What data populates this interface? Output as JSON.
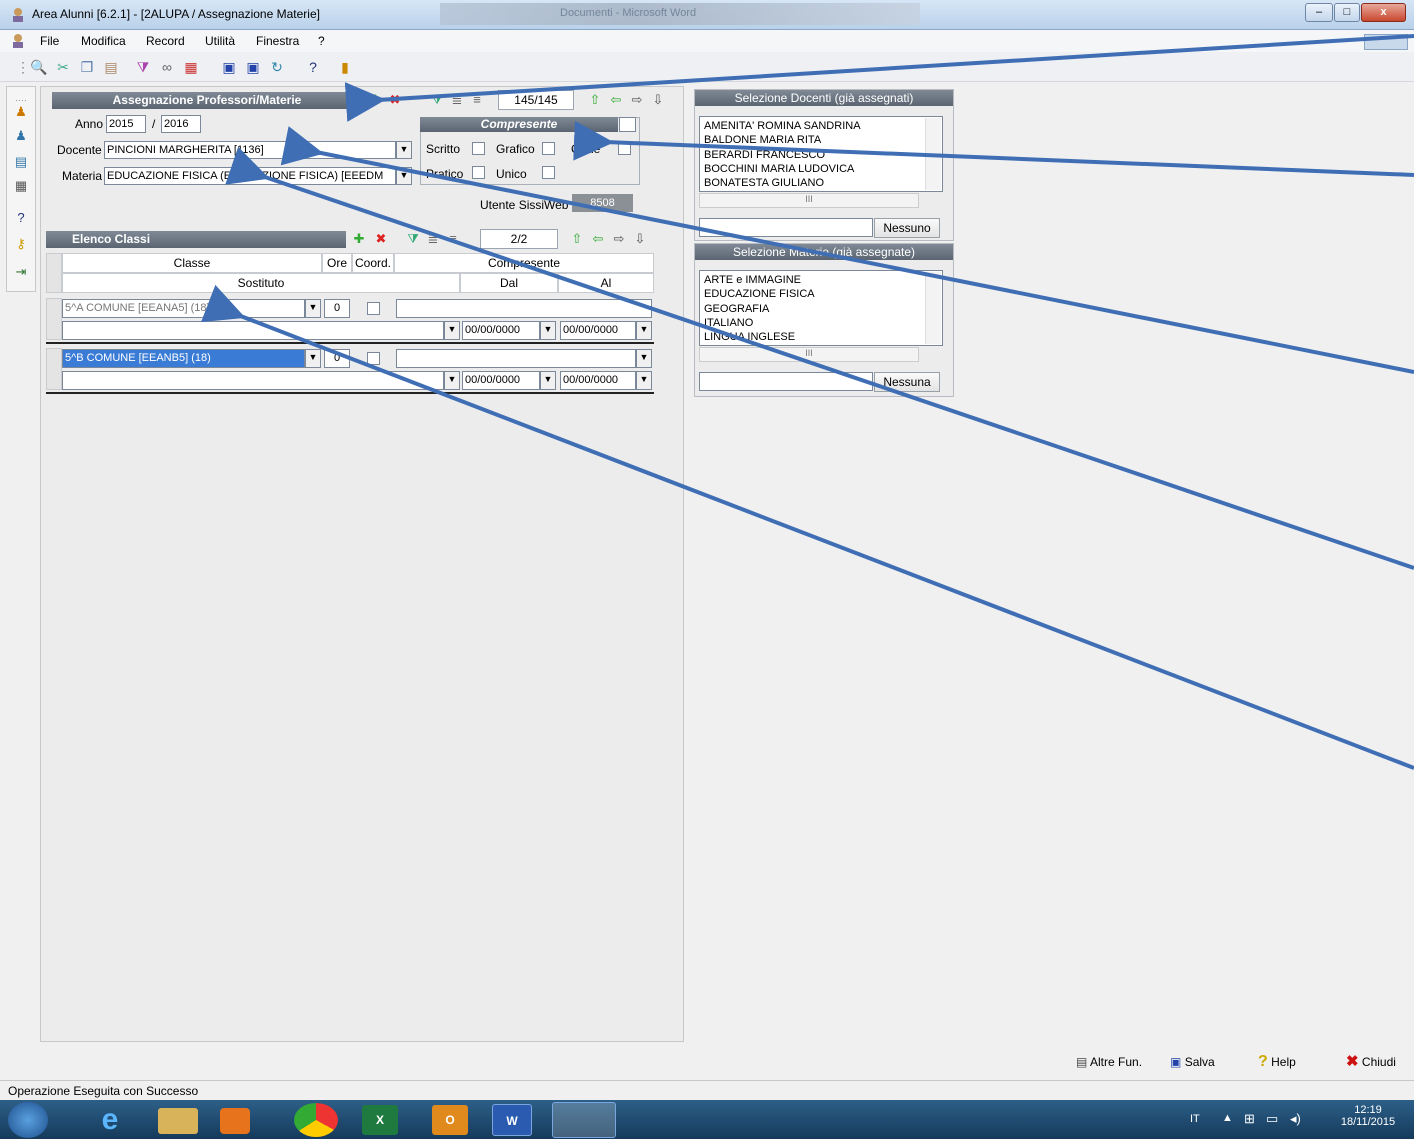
{
  "window": {
    "title": "Area Alunni [6.2.1] - [2ALUPA / Assegnazione Materie]",
    "blurred_title": "Documenti - Microsoft Word",
    "min_label": "–",
    "max_label": "□",
    "close_label": "x"
  },
  "menu": [
    "File",
    "Modifica",
    "Record",
    "Utilità",
    "Finestra",
    "?"
  ],
  "assign_panel": {
    "header": "Assegnazione Professori/Materie",
    "record_counter": "145/145",
    "anno_label": "Anno",
    "anno_from": "2015",
    "anno_sep": "/",
    "anno_to": "2016",
    "docente_label": "Docente",
    "docente_value": "PINCIONI MARGHERITA [1136]",
    "materia_label": "Materia",
    "materia_value": "EDUCAZIONE FISICA (EDUCAZIONE FISICA) [EEEDM",
    "compresente_header": "Compresente",
    "scritto_label": "Scritto",
    "grafico_label": "Grafico",
    "orale_label": "Orale",
    "pratico_label": "Pratico",
    "unico_label": "Unico",
    "utente_label": "Utente SissiWeb",
    "utente_value": "8508"
  },
  "classes_panel": {
    "header": "Elenco Classi",
    "record_counter": "2/2",
    "col_classe": "Classe",
    "col_ore": "Ore",
    "col_coord": "Coord.",
    "col_compresente": "Compresente",
    "col_sostituto": "Sostituto",
    "col_dal": "Dal",
    "col_al": "Al",
    "rows": [
      {
        "classe": "5^A COMUNE [EEANA5] (18)",
        "ore": "0",
        "dal": "00/00/0000",
        "al": "00/00/0000"
      },
      {
        "classe": "5^B COMUNE [EEANB5] (18)",
        "ore": "0",
        "dal": "00/00/0000",
        "al": "00/00/0000"
      }
    ]
  },
  "docenti_panel": {
    "header": "Selezione Docenti (già assegnati)",
    "items": [
      "AMENITA' ROMINA SANDRINA",
      "BALDONE MARIA RITA",
      "BERARDI FRANCESCO",
      "BOCCHINI MARIA LUDOVICA",
      "BONATESTA GIULIANO"
    ],
    "button": "Nessuno",
    "scroll_mark": "III"
  },
  "materie_panel": {
    "header": "Selezione Materie (già assegnate)",
    "items": [
      "ARTE e IMMAGINE",
      "EDUCAZIONE FISICA",
      "GEOGRAFIA",
      "ITALIANO",
      "LINGUA INGLESE"
    ],
    "button": "Nessuna",
    "scroll_mark": "III"
  },
  "bottom_buttons": {
    "altre": "Altre Fun.",
    "salva": "Salva",
    "help": "Help",
    "chiudi": "Chiudi"
  },
  "status": "Operazione Eseguita con Successo",
  "tray": {
    "lang": "IT",
    "time": "12:19",
    "date": "18/11/2015"
  },
  "colors": {
    "header": "#6b7580",
    "selection": "#3a7bd5",
    "annotation_arrow": "#3f6eb4"
  }
}
